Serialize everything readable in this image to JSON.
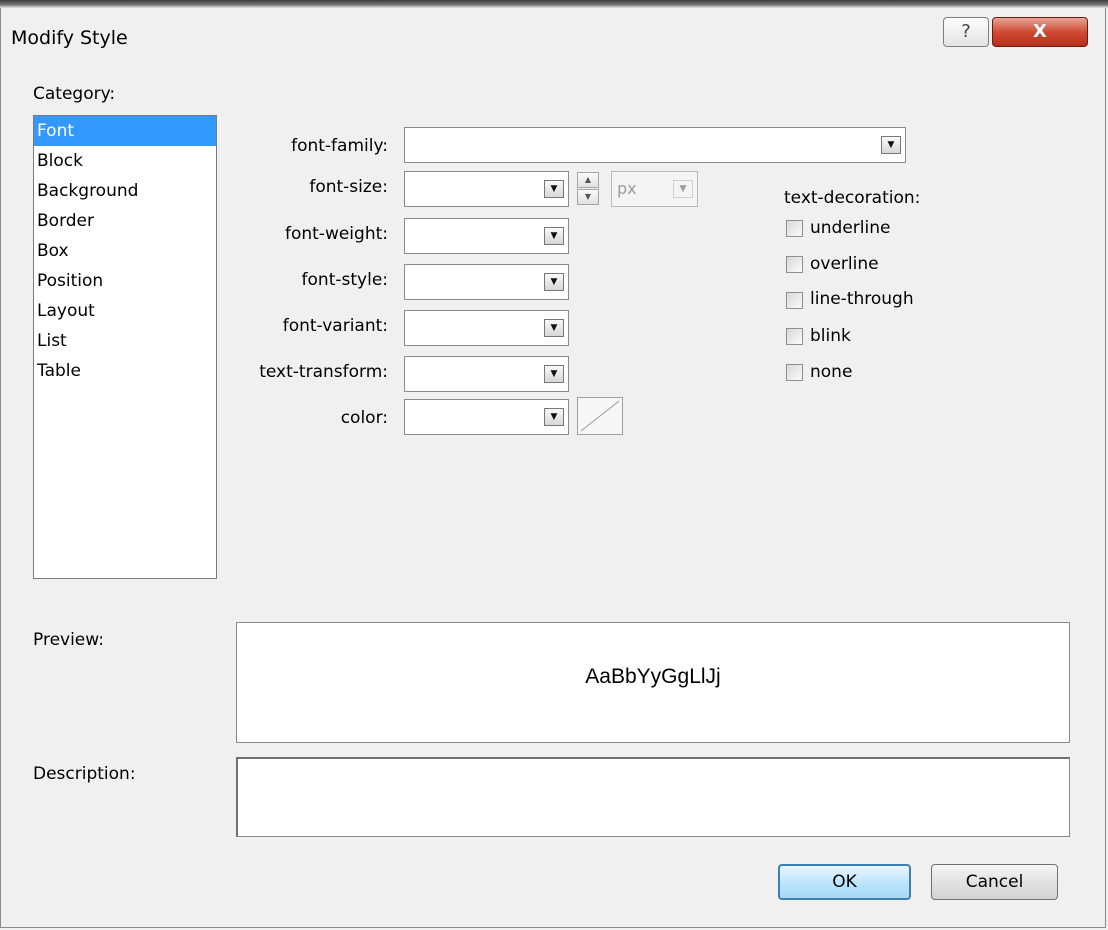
{
  "window": {
    "title": "Modify Style",
    "help_glyph": "?",
    "close_glyph": "X"
  },
  "category": {
    "label": "Category:",
    "items": [
      "Font",
      "Block",
      "Background",
      "Border",
      "Box",
      "Position",
      "Layout",
      "List",
      "Table"
    ],
    "selected": "Font"
  },
  "font": {
    "family_label": "font-family:",
    "size_label": "font-size:",
    "weight_label": "font-weight:",
    "style_label": "font-style:",
    "variant_label": "font-variant:",
    "transform_label": "text-transform:",
    "color_label": "color:",
    "size_unit": "px",
    "dropdown_glyph": "▼",
    "spin_up_glyph": "▲",
    "spin_down_glyph": "▼"
  },
  "text_decoration": {
    "label": "text-decoration:",
    "options": [
      "underline",
      "overline",
      "line-through",
      "blink",
      "none"
    ]
  },
  "preview": {
    "label": "Preview:",
    "sample": "AaBbYyGgLlJj"
  },
  "description": {
    "label": "Description:",
    "value": ""
  },
  "buttons": {
    "ok": "OK",
    "cancel": "Cancel"
  },
  "colors": {
    "selection": "#3399ff",
    "close_button": "#c94431",
    "ok_border": "#3c7fb1"
  }
}
